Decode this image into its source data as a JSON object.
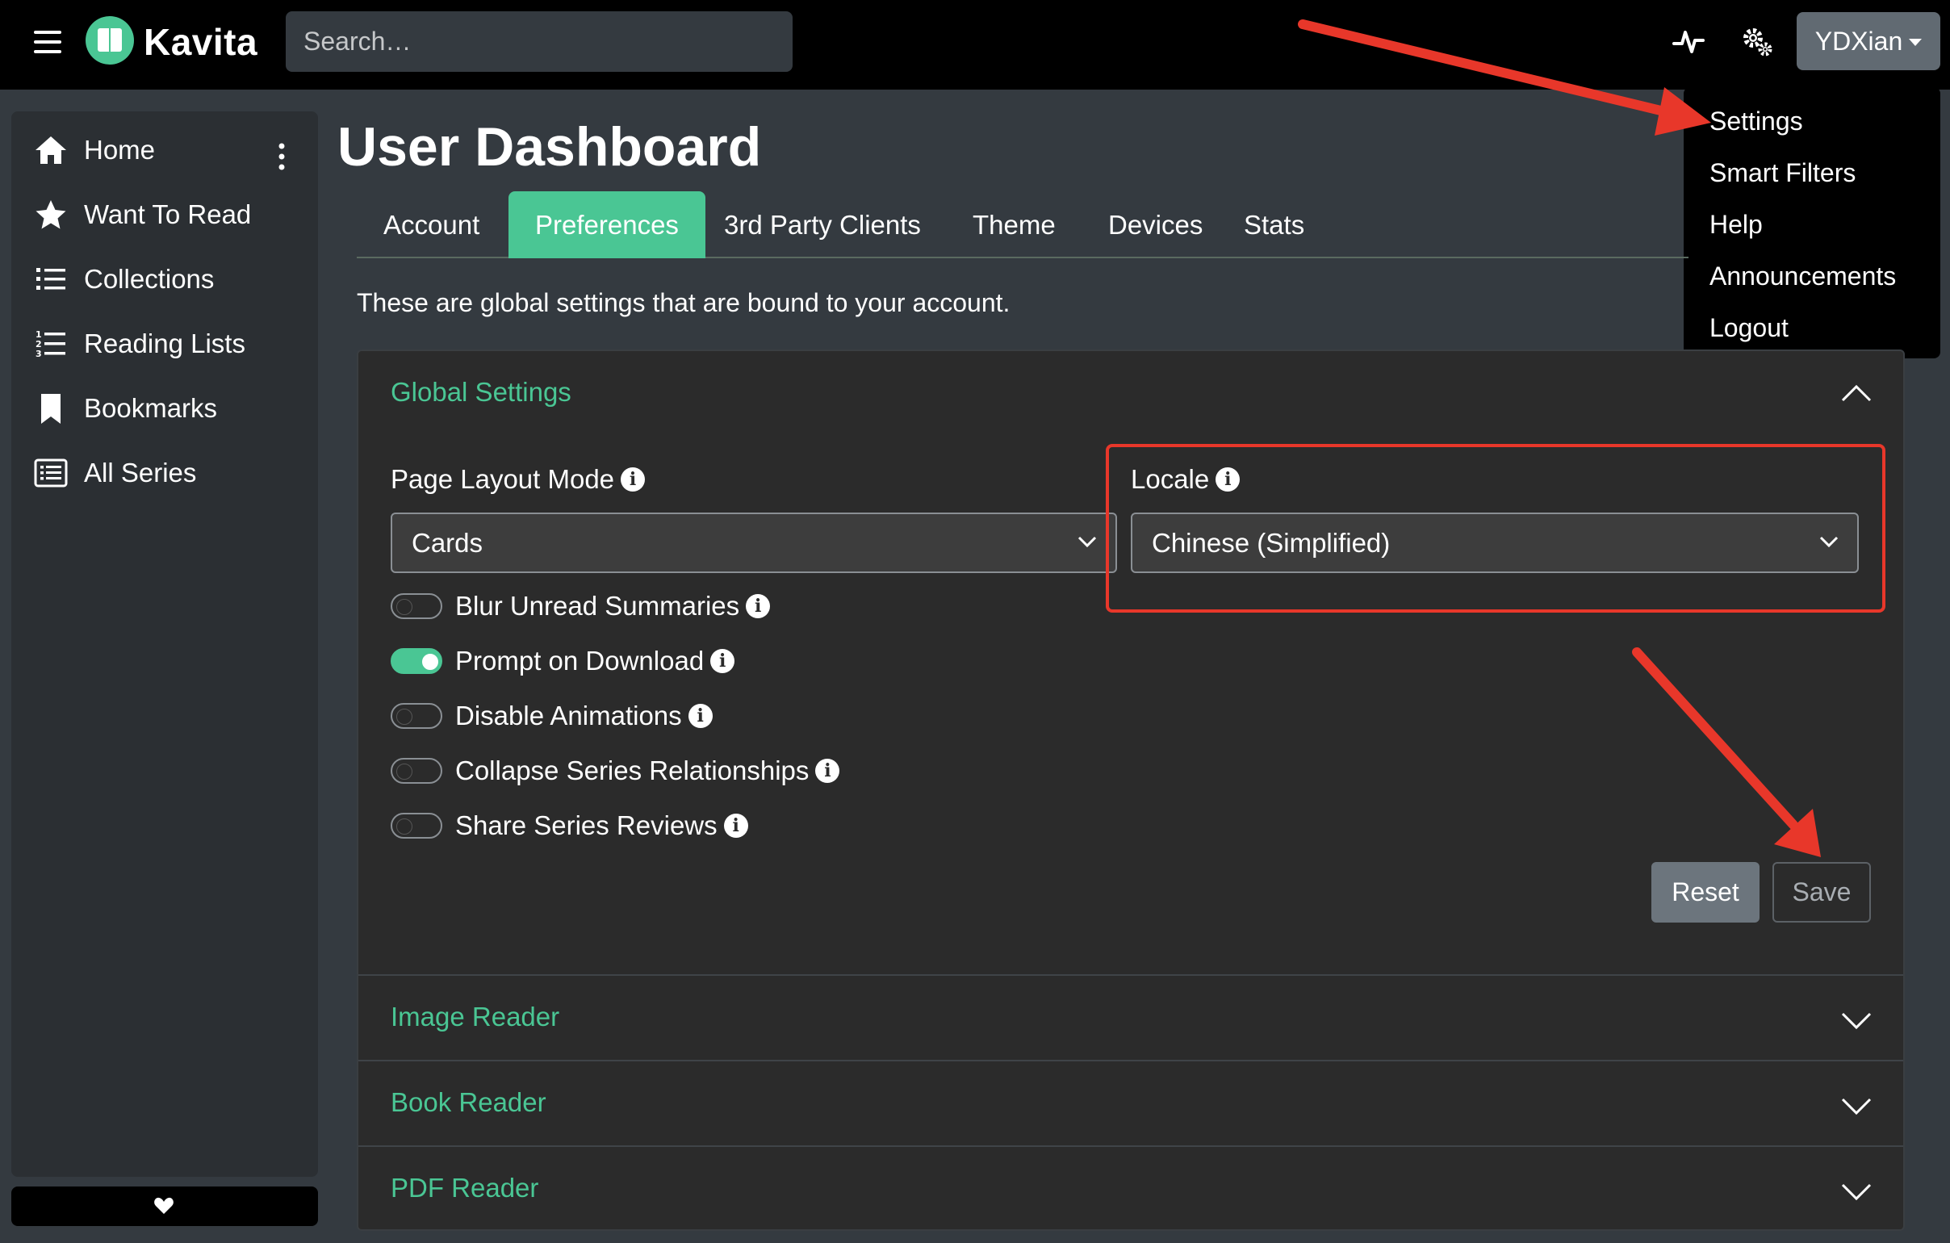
{
  "app": {
    "brand": "Kavita",
    "search_placeholder": "Search…",
    "user": "YDXian"
  },
  "user_menu": [
    "Settings",
    "Smart Filters",
    "Help",
    "Announcements",
    "Logout"
  ],
  "sidebar": {
    "items": [
      {
        "label": "Home",
        "icon": "home-icon"
      },
      {
        "label": "Want To Read",
        "icon": "star-icon"
      },
      {
        "label": "Collections",
        "icon": "list-icon"
      },
      {
        "label": "Reading Lists",
        "icon": "numbered-list-icon"
      },
      {
        "label": "Bookmarks",
        "icon": "bookmark-icon"
      },
      {
        "label": "All Series",
        "icon": "list-box-icon"
      }
    ]
  },
  "page": {
    "title": "User Dashboard",
    "tabs": [
      "Account",
      "Preferences",
      "3rd Party Clients",
      "Theme",
      "Devices",
      "Stats"
    ],
    "active_tab": "Preferences",
    "description": "These are global settings that are bound to your account."
  },
  "global_settings": {
    "title": "Global Settings",
    "page_layout_label": "Page Layout Mode",
    "page_layout_value": "Cards",
    "locale_label": "Locale",
    "locale_value": "Chinese (Simplified)",
    "toggles": [
      {
        "label": "Blur Unread Summaries",
        "on": false
      },
      {
        "label": "Prompt on Download",
        "on": true
      },
      {
        "label": "Disable Animations",
        "on": false
      },
      {
        "label": "Collapse Series Relationships",
        "on": false
      },
      {
        "label": "Share Series Reviews",
        "on": false
      }
    ],
    "reset_label": "Reset",
    "save_label": "Save"
  },
  "sections": [
    "Image Reader",
    "Book Reader",
    "PDF Reader"
  ],
  "colors": {
    "accent": "#4ac694",
    "annotation": "#e8372a",
    "topbar": "#000000",
    "background": "#343a40"
  }
}
